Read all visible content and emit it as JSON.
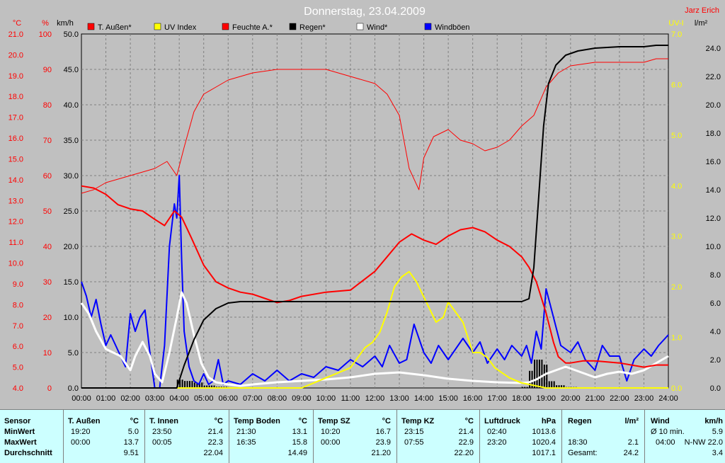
{
  "title": "Donnerstag, 23.04.2009",
  "author": "Jarz Erich",
  "colors": {
    "temp": "#ff0000",
    "uv": "#ffff00",
    "humidity": "#ff0000",
    "rain": "#000000",
    "wind": "#ffffff",
    "gust": "#0000ff",
    "plot_bg": "#c0c0c0",
    "grid": "#808080"
  },
  "axis_units": {
    "temp": "°C",
    "humidity": "%",
    "wind": "km/h",
    "uv": "UV-I",
    "rain": "l/m²"
  },
  "legend": [
    {
      "label": "T. Außen*",
      "color": "#ff0000"
    },
    {
      "label": "UV Index",
      "color": "#ffff00"
    },
    {
      "label": "Feuchte A.*",
      "color": "#ff0000"
    },
    {
      "label": "Regen*",
      "color": "#000000"
    },
    {
      "label": "Wind*",
      "color": "#ffffff"
    },
    {
      "label": "Windböen",
      "color": "#0000ff"
    }
  ],
  "chart_data": {
    "type": "line",
    "title": "Donnerstag, 23.04.2009",
    "x_ticks": [
      "00:00",
      "01:00",
      "02:00",
      "03:00",
      "04:00",
      "05:00",
      "06:00",
      "07:00",
      "08:00",
      "09:00",
      "10:00",
      "11:00",
      "12:00",
      "13:00",
      "14:00",
      "15:00",
      "16:00",
      "17:00",
      "18:00",
      "19:00",
      "20:00",
      "21:00",
      "22:00",
      "23:00",
      "24:00"
    ],
    "axes": {
      "temp": {
        "label": "°C",
        "ylim": [
          4.0,
          21.0
        ],
        "ticks": [
          "4.0",
          "5.0",
          "6.0",
          "7.0",
          "8.0",
          "9.0",
          "10.0",
          "11.0",
          "12.0",
          "13.0",
          "14.0",
          "15.0",
          "16.0",
          "17.0",
          "18.0",
          "19.0",
          "20.0",
          "21.0"
        ]
      },
      "humidity": {
        "label": "%",
        "ylim": [
          0,
          100
        ],
        "ticks": [
          "0",
          "10",
          "20",
          "30",
          "40",
          "50",
          "60",
          "70",
          "80",
          "90",
          "100"
        ]
      },
      "wind": {
        "label": "km/h",
        "ylim": [
          0.0,
          50.0
        ],
        "ticks": [
          "0.0",
          "5.0",
          "10.0",
          "15.0",
          "20.0",
          "25.0",
          "30.0",
          "35.0",
          "40.0",
          "45.0",
          "50.0"
        ]
      },
      "uv": {
        "label": "UV-I",
        "ylim": [
          0.0,
          7.0
        ],
        "ticks": [
          "0.0",
          "1.0",
          "2.0",
          "3.0",
          "4.0",
          "5.0",
          "6.0",
          "7.0"
        ]
      },
      "rain": {
        "label": "l/m²",
        "ylim": [
          0.0,
          25.0
        ],
        "ticks": [
          "0.0",
          "2.0",
          "4.0",
          "6.0",
          "8.0",
          "10.0",
          "12.0",
          "14.0",
          "16.0",
          "18.0",
          "20.0",
          "22.0",
          "24.0"
        ]
      }
    },
    "grid": true,
    "series": [
      {
        "name": "T. Außen*",
        "axis": "temp",
        "x": [
          0,
          0.5,
          1,
          1.5,
          2,
          2.5,
          3,
          3.4,
          3.8,
          4.1,
          4.5,
          5,
          5.5,
          6,
          6.5,
          7,
          7.5,
          8,
          8.5,
          9,
          10,
          11,
          12,
          12.5,
          13,
          13.5,
          14,
          14.5,
          15,
          15.5,
          16,
          16.5,
          17,
          17.5,
          18,
          18.3,
          18.6,
          19,
          19.3,
          19.5,
          19.8,
          20,
          20.5,
          21,
          22,
          23,
          23.5,
          24
        ],
        "y": [
          13.7,
          13.6,
          13.3,
          12.8,
          12.6,
          12.5,
          12.1,
          11.8,
          12.5,
          12.2,
          11.2,
          9.9,
          9.1,
          8.8,
          8.6,
          8.5,
          8.3,
          8.1,
          8.2,
          8.4,
          8.6,
          8.7,
          9.6,
          10.3,
          11.0,
          11.4,
          11.1,
          10.9,
          11.3,
          11.6,
          11.7,
          11.5,
          11.1,
          10.8,
          10.3,
          9.8,
          9.1,
          7.6,
          6.2,
          5.5,
          5.2,
          5.2,
          5.3,
          5.3,
          5.2,
          5.0,
          5.1,
          5.1
        ]
      },
      {
        "name": "Feuchte A.*",
        "axis": "humidity",
        "x": [
          0,
          0.5,
          1,
          1.5,
          2,
          2.5,
          3,
          3.5,
          3.9,
          4.2,
          4.6,
          5,
          5.5,
          6,
          7,
          8,
          9,
          10,
          11,
          12,
          12.5,
          13,
          13.4,
          13.8,
          14,
          14.4,
          15,
          15.5,
          16,
          16.5,
          17,
          17.5,
          18,
          18.5,
          19,
          19.5,
          20,
          21,
          22,
          23,
          23.5,
          24
        ],
        "y": [
          55,
          56,
          58,
          59,
          60,
          61,
          62,
          64,
          60,
          68,
          78,
          83,
          85,
          87,
          89,
          90,
          90,
          90,
          88,
          86,
          83,
          77,
          62,
          56,
          65,
          71,
          73,
          70,
          69,
          67,
          68,
          70,
          74,
          77,
          85,
          89,
          91,
          92,
          92,
          92,
          93,
          93
        ]
      },
      {
        "name": "Regen*",
        "axis": "rain",
        "x": [
          0,
          3.9,
          4.2,
          4.6,
          5,
          5.5,
          6,
          6.5,
          7,
          18,
          18.3,
          18.5,
          18.7,
          18.9,
          19.1,
          19.4,
          19.8,
          20.3,
          21,
          22,
          23,
          23.5,
          24
        ],
        "y": [
          0,
          0,
          1.6,
          3.4,
          4.8,
          5.6,
          6.0,
          6.1,
          6.1,
          6.1,
          6.3,
          8.5,
          13.5,
          18.5,
          21.5,
          22.8,
          23.5,
          23.8,
          24.0,
          24.1,
          24.1,
          24.2,
          24.2
        ]
      },
      {
        "name": "UV Index",
        "axis": "uv",
        "x": [
          0,
          9,
          9.5,
          10,
          10.5,
          11,
          11.3,
          11.6,
          11.9,
          12.2,
          12.5,
          12.8,
          13.1,
          13.4,
          13.7,
          14,
          14.2,
          14.5,
          14.8,
          15,
          15.3,
          15.6,
          15.8,
          16,
          16.3,
          16.6,
          16.9,
          17.2,
          17.5,
          18,
          18.5,
          19,
          24
        ],
        "y": [
          0,
          0,
          0.1,
          0.2,
          0.3,
          0.4,
          0.6,
          0.8,
          0.9,
          1.1,
          1.5,
          2.0,
          2.2,
          2.3,
          2.1,
          1.8,
          1.6,
          1.3,
          1.4,
          1.7,
          1.5,
          1.3,
          1.0,
          0.7,
          0.7,
          0.6,
          0.4,
          0.3,
          0.2,
          0.1,
          0.05,
          0,
          0
        ]
      },
      {
        "name": "Wind*",
        "axis": "wind",
        "x": [
          0,
          0.3,
          0.6,
          1,
          1.3,
          1.6,
          2,
          2.2,
          2.5,
          2.8,
          3,
          3.3,
          3.6,
          3.9,
          4.1,
          4.3,
          4.6,
          4.9,
          5.2,
          5.5,
          6,
          6.5,
          7,
          8,
          9,
          10,
          11,
          12,
          13,
          14,
          15,
          16,
          17,
          18,
          18.3,
          18.6,
          19,
          19.4,
          19.8,
          20.2,
          20.6,
          21,
          21.5,
          22,
          22.5,
          23,
          23.5,
          24
        ],
        "y": [
          12.0,
          10.5,
          8.0,
          5.5,
          5.0,
          4.5,
          2.5,
          4.5,
          6.5,
          4.5,
          2.0,
          0.8,
          5.0,
          10.0,
          13.5,
          12.0,
          7.5,
          3.5,
          1.5,
          0.8,
          0.5,
          0.3,
          0.5,
          0.8,
          1.0,
          1.2,
          1.5,
          2.0,
          2.2,
          1.8,
          1.3,
          1.0,
          0.8,
          0.7,
          0.8,
          1.2,
          2.0,
          2.5,
          3.0,
          2.5,
          2.0,
          1.5,
          2.0,
          2.3,
          2.0,
          2.5,
          3.5,
          4.5
        ]
      },
      {
        "name": "Windböen",
        "axis": "wind",
        "x": [
          0,
          0.2,
          0.4,
          0.6,
          0.8,
          1,
          1.2,
          1.4,
          1.6,
          1.8,
          2,
          2.2,
          2.4,
          2.6,
          2.8,
          3,
          3.2,
          3.4,
          3.6,
          3.8,
          3.9,
          4,
          4.1,
          4.2,
          4.4,
          4.6,
          4.8,
          5,
          5.2,
          5.4,
          5.6,
          5.8,
          6,
          6.5,
          7,
          7.5,
          8,
          8.5,
          9,
          9.5,
          10,
          10.5,
          11,
          11.5,
          12,
          12.3,
          12.6,
          13,
          13.3,
          13.6,
          14,
          14.3,
          14.6,
          15,
          15.3,
          15.6,
          16,
          16.3,
          16.6,
          17,
          17.3,
          17.6,
          18,
          18.2,
          18.4,
          18.6,
          18.8,
          19,
          19.3,
          19.6,
          20,
          20.3,
          20.6,
          21,
          21.3,
          21.6,
          22,
          22.3,
          22.6,
          23,
          23.3,
          23.6,
          24
        ],
        "y": [
          15.0,
          13.0,
          10.0,
          12.5,
          9.0,
          6.0,
          7.5,
          6.0,
          4.5,
          3.0,
          10.5,
          8.0,
          10.0,
          11.0,
          5.0,
          0.0,
          0.0,
          6.0,
          20.0,
          26.0,
          24.0,
          30.0,
          18.0,
          8.0,
          3.0,
          1.0,
          0.5,
          2.0,
          0.5,
          1.0,
          4.0,
          0.5,
          1.0,
          0.5,
          2.0,
          1.0,
          2.5,
          1.0,
          2.0,
          1.5,
          3.0,
          2.5,
          4.0,
          3.0,
          4.5,
          3.0,
          6.0,
          3.5,
          4.0,
          9.0,
          5.0,
          3.5,
          6.0,
          4.0,
          5.5,
          7.0,
          5.0,
          6.5,
          3.5,
          5.5,
          4.0,
          6.0,
          4.5,
          6.0,
          3.5,
          8.0,
          5.5,
          14.0,
          10.0,
          6.0,
          5.0,
          6.5,
          4.0,
          2.5,
          6.0,
          4.5,
          4.5,
          1.0,
          4.0,
          5.5,
          4.5,
          6.0,
          7.5
        ]
      }
    ]
  },
  "stats": {
    "row_labels": [
      "Sensor",
      "MinWert",
      "MaxWert",
      "Durchschnitt"
    ],
    "columns": [
      {
        "name": "T. Außen",
        "unit": "°C",
        "min_time": "19:20",
        "min_val": "5.0",
        "max_time": "00:00",
        "max_val": "13.7",
        "avg": "9.51"
      },
      {
        "name": "T. Innen",
        "unit": "°C",
        "min_time": "23:50",
        "min_val": "21.4",
        "max_time": "00:05",
        "max_val": "22.3",
        "avg": "22.04"
      },
      {
        "name": "Temp Boden",
        "unit": "°C",
        "min_time": "21:30",
        "min_val": "13.1",
        "max_time": "16:35",
        "max_val": "15.8",
        "avg": "14.49"
      },
      {
        "name": "Temp SZ",
        "unit": "°C",
        "min_time": "10:20",
        "min_val": "16.7",
        "max_time": "00:00",
        "max_val": "23.9",
        "avg": "21.20"
      },
      {
        "name": "Temp KZ",
        "unit": "°C",
        "min_time": "23:15",
        "min_val": "21.4",
        "max_time": "07:55",
        "max_val": "22.9",
        "avg": "22.20"
      },
      {
        "name": "Luftdruck",
        "unit": "hPa",
        "min_time": "02:40",
        "min_val": "1013.6",
        "max_time": "23:20",
        "max_val": "1020.4",
        "avg": "1017.1"
      }
    ],
    "rain": {
      "name": "Regen",
      "unit": "l/m²",
      "max_time": "18:30",
      "max_val": "2.1",
      "total_label": "Gesamt:",
      "total_val": "24.2"
    },
    "wind": {
      "name": "Wind",
      "unit": "km/h",
      "avg10_label": "Ø 10 min.",
      "avg10_val": "5.9",
      "max_time": "04:00",
      "max_val": "N-NW 22.0",
      "avg": "3.4"
    }
  }
}
